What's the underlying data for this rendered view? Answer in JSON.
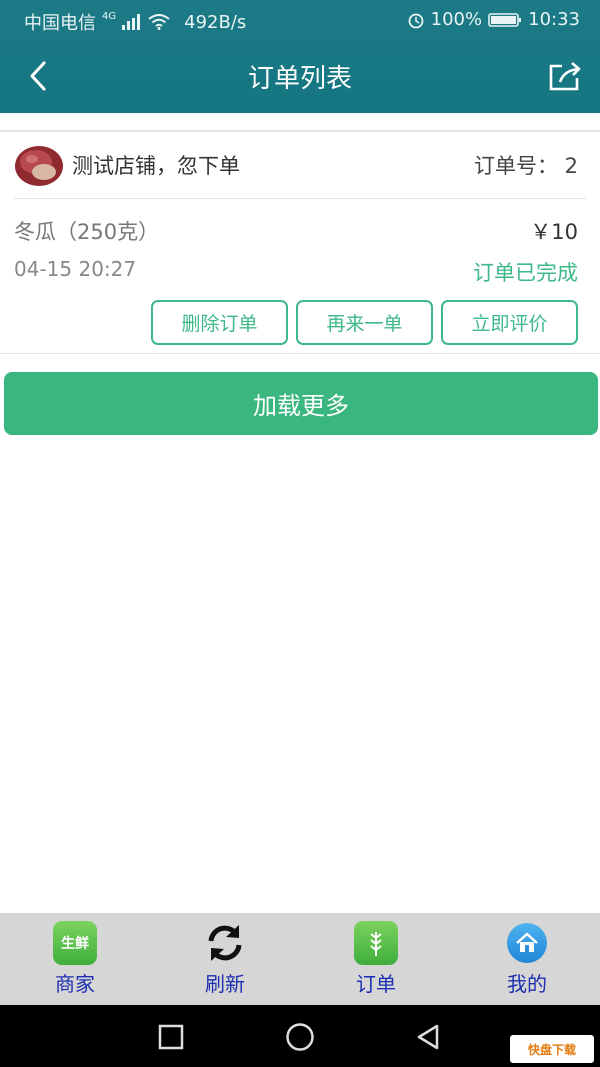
{
  "statusbar": {
    "carrier": "中国电信",
    "network": "4G",
    "speed": "492B/s",
    "battery": "100%",
    "time": "10:33"
  },
  "header": {
    "title": "订单列表",
    "back_icon": "chevron-left-icon",
    "share_icon": "share-icon"
  },
  "order": {
    "shop_name": "测试店铺，忽下单",
    "order_no": "订单号： 2",
    "item_name": "冬瓜（250克）",
    "price": "￥10",
    "time": "04-15 20:27",
    "status": "订单已完成",
    "buttons": {
      "delete": "删除订单",
      "reorder": "再来一单",
      "review": "立即评价"
    }
  },
  "load_more": "加载更多",
  "tabbar": {
    "items": [
      {
        "label": "商家",
        "icon": "fresh-produce-icon",
        "icon_text": "生鲜"
      },
      {
        "label": "刷新",
        "icon": "refresh-icon"
      },
      {
        "label": "订单",
        "icon": "wheat-icon"
      },
      {
        "label": "我的",
        "icon": "home-icon"
      }
    ]
  },
  "watermark": "快盘下载",
  "colors": {
    "header": "#147682",
    "accent": "#3fb88a",
    "load_more": "#39b77f",
    "tab_label": "#1d2fb0"
  }
}
